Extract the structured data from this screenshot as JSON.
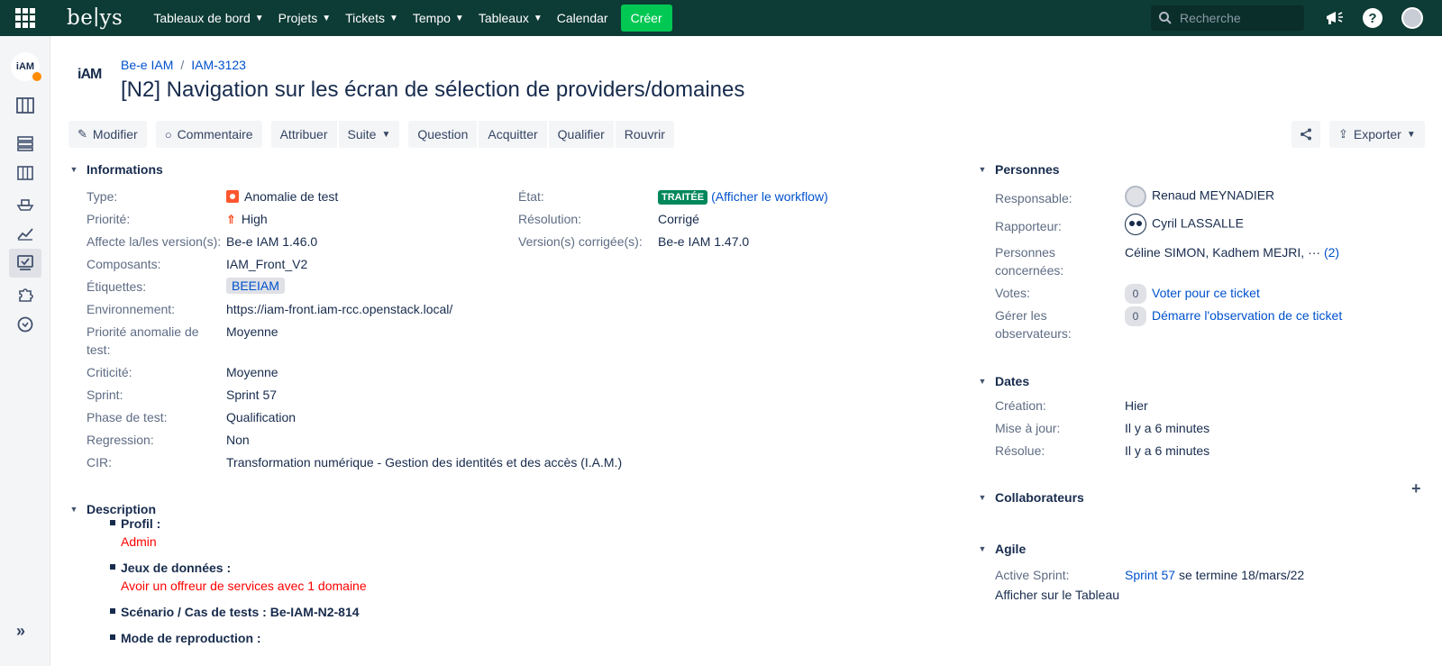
{
  "topbar": {
    "logo": "be∣ys",
    "nav": [
      "Tableaux de bord",
      "Projets",
      "Tickets",
      "Tempo",
      "Tableaux"
    ],
    "calendar": "Calendar",
    "create": "Créer",
    "search_placeholder": "Recherche"
  },
  "header": {
    "project_logo": "iAM",
    "breadcrumb_project": "Be-e IAM",
    "breadcrumb_key": "IAM-3123",
    "title": "[N2] Navigation sur les écran de sélection de providers/domaines"
  },
  "toolbar": {
    "edit": "Modifier",
    "comment": "Commentaire",
    "assign": "Attribuer",
    "more": "Suite",
    "question": "Question",
    "acquit": "Acquitter",
    "qualify": "Qualifier",
    "reopen": "Rouvrir",
    "export": "Exporter"
  },
  "informations": {
    "heading": "Informations",
    "left": [
      {
        "label": "Type:",
        "value": "Anomalie de test"
      },
      {
        "label": "Priorité:",
        "value": "High"
      },
      {
        "label": "Affecte la/les version(s):",
        "value": "Be-e IAM 1.46.0"
      },
      {
        "label": "Composants:",
        "value": "IAM_Front_V2"
      },
      {
        "label": "Étiquettes:",
        "value": "BEEIAM"
      },
      {
        "label": "Environnement:",
        "value": "https://iam-front.iam-rcc.openstack.local/"
      },
      {
        "label": "Priorité anomalie de",
        "label2": "test:",
        "value": "Moyenne"
      },
      {
        "label": "Criticité:",
        "value": "Moyenne"
      },
      {
        "label": "Sprint:",
        "value": "Sprint 57"
      },
      {
        "label": "Phase de test:",
        "value": "Qualification"
      },
      {
        "label": "Regression:",
        "value": "Non"
      },
      {
        "label": "CIR:",
        "value": "Transformation numérique - Gestion des identités et des accès (I.A.M.)"
      }
    ],
    "right": [
      {
        "label": "État:",
        "status": "TRAITÉE",
        "open_paren": "(",
        "link": "Afficher le workflow",
        "close_paren": ")"
      },
      {
        "label": "Résolution:",
        "value": "Corrigé"
      },
      {
        "label": "Version(s) corrigée(s):",
        "value": "Be-e IAM 1.47.0"
      }
    ]
  },
  "description": {
    "heading": "Description",
    "items": [
      {
        "title": "Profil :",
        "text": "Admin"
      },
      {
        "title": "Jeux de données :",
        "text": "Avoir un offreur de services avec 1 domaine"
      },
      {
        "title": "Scénario / Cas de tests : Be-IAM-N2-814",
        "text": ""
      },
      {
        "title": "Mode de reproduction :",
        "text": ""
      }
    ]
  },
  "personnes": {
    "heading": "Personnes",
    "assignee_label": "Responsable:",
    "assignee": "Renaud MEYNADIER",
    "reporter_label": "Rapporteur:",
    "reporter": "Cyril LASSALLE",
    "concerned_label1": "Personnes",
    "concerned_label2": "concernées:",
    "concerned": "Céline SIMON, Kadhem MEJRI,",
    "concerned_more": "···",
    "concerned_count": "(2)",
    "votes_label": "Votes:",
    "votes_count": "0",
    "votes_link": "Voter pour ce ticket",
    "watchers_label1": "Gérer les",
    "watchers_label2": "observateurs:",
    "watchers_count": "0",
    "watchers_link": "Démarre l'observation de ce ticket"
  },
  "dates": {
    "heading": "Dates",
    "created_label": "Création:",
    "created": "Hier",
    "updated_label": "Mise à jour:",
    "updated": "Il y a 6 minutes",
    "resolved_label": "Résolue:",
    "resolved": "Il y a 6 minutes"
  },
  "collaborateurs": {
    "heading": "Collaborateurs"
  },
  "agile": {
    "heading": "Agile",
    "sprint_label": "Active Sprint:",
    "sprint_link": "Sprint 57",
    "sprint_end": "se termine 18/mars/22",
    "board_link": "Afficher sur le Tableau"
  },
  "colors": {
    "topbar": "#0d3b35",
    "create": "#00c853",
    "link": "#0052cc",
    "status": "#00875a",
    "desc_red": "#ff0000"
  }
}
